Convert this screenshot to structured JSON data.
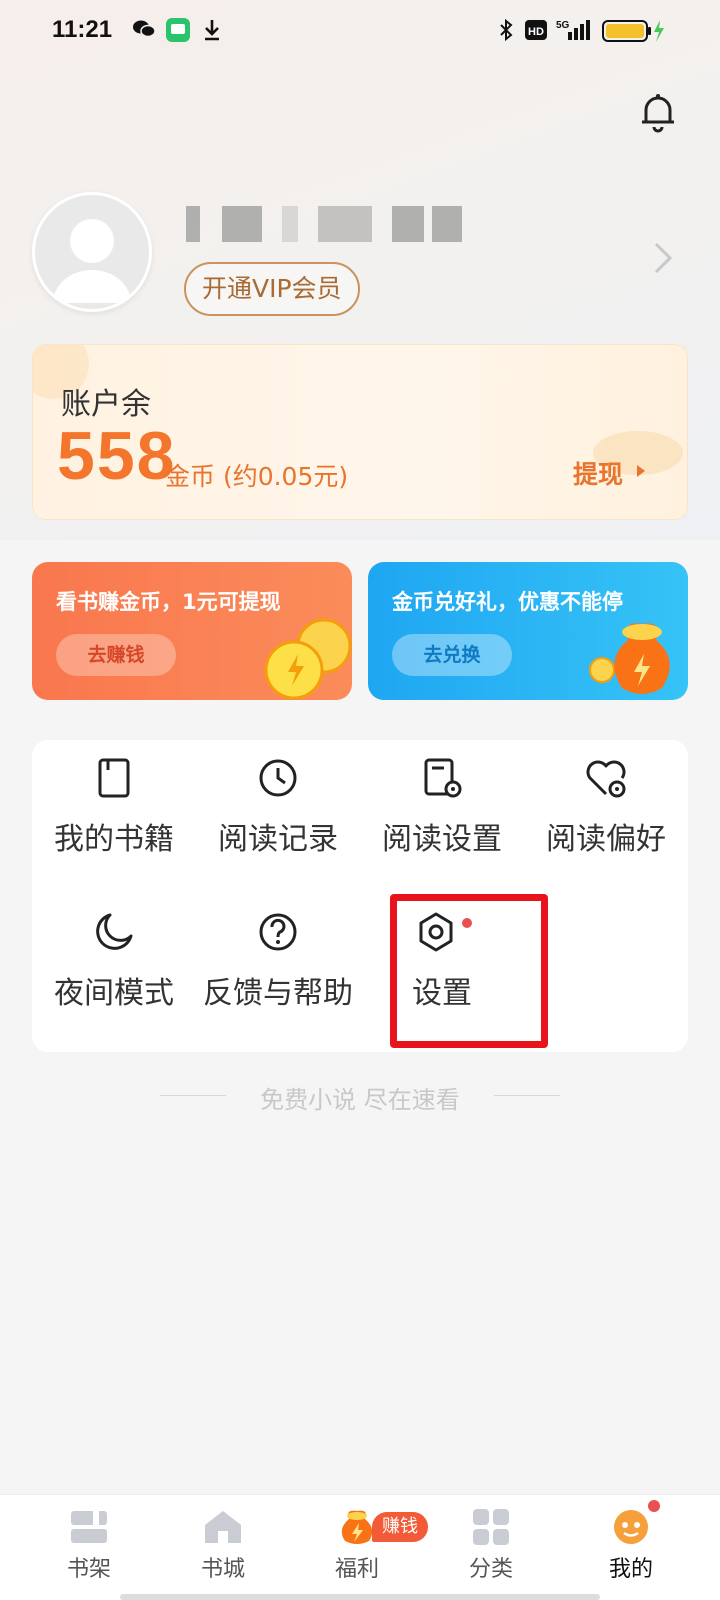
{
  "status_bar": {
    "time": "11:21",
    "network": "5G"
  },
  "profile": {
    "vip_label": "开通VIP会员"
  },
  "balance": {
    "label": "账户余",
    "amount": "558",
    "unit_text": "金币 (约0.05元)",
    "withdraw_label": "提现"
  },
  "promos": [
    {
      "title": "看书赚金币，1元可提现",
      "button": "去赚钱"
    },
    {
      "title": "金币兑好礼，优惠不能停",
      "button": "去兑换"
    }
  ],
  "menu": {
    "items": [
      {
        "label": "我的书籍",
        "icon": "book-icon"
      },
      {
        "label": "阅读记录",
        "icon": "clock-icon"
      },
      {
        "label": "阅读设置",
        "icon": "reading-settings-icon"
      },
      {
        "label": "阅读偏好",
        "icon": "heart-settings-icon"
      },
      {
        "label": "夜间模式",
        "icon": "moon-icon"
      },
      {
        "label": "反馈与帮助",
        "icon": "help-icon"
      },
      {
        "label": "设置",
        "icon": "settings-icon"
      }
    ]
  },
  "tagline": "免费小说 尽在速看",
  "bottom_nav": {
    "items": [
      {
        "label": "书架",
        "icon": "bookshelf-icon"
      },
      {
        "label": "书城",
        "icon": "home-icon"
      },
      {
        "label": "福利",
        "icon": "gift-bag-icon"
      },
      {
        "label": "分类",
        "icon": "grid-icon"
      },
      {
        "label": "我的",
        "icon": "profile-icon"
      }
    ],
    "earn_badge": "赚钱",
    "active": "我的"
  },
  "colors": {
    "accent": "#f3762c",
    "vip": "#a86b33",
    "highlight": "#e8141b"
  }
}
